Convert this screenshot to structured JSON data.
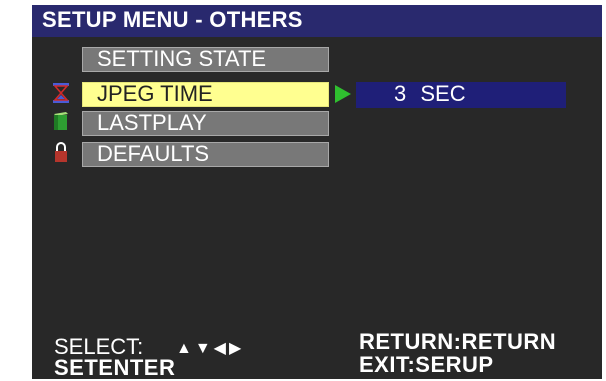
{
  "title": "SETUP MENU - OTHERS",
  "menu": {
    "items": [
      {
        "label": "SETTING STATE",
        "icon": "none"
      },
      {
        "label": "JPEG TIME",
        "icon": "hourglass-icon",
        "selected": true
      },
      {
        "label": "LASTPLAY",
        "icon": "green-box-icon"
      },
      {
        "label": "DEFAULTS",
        "icon": "lock-icon"
      }
    ]
  },
  "value": {
    "text": "3  SEC"
  },
  "footer": {
    "select_label": "SELECT:",
    "nav_glyphs": "▲▼◀▶",
    "setenter_label": "SETENTER",
    "return_label": "RETURN:RETURN",
    "exit_label": "EXIT:SERUP"
  },
  "colors": {
    "title_bar": "#29296e",
    "screen_bg": "#282828",
    "menu_item": "#787878",
    "menu_selected": "#ffff90",
    "value_box": "#1f1f78",
    "arrow": "#2fbf2f"
  }
}
